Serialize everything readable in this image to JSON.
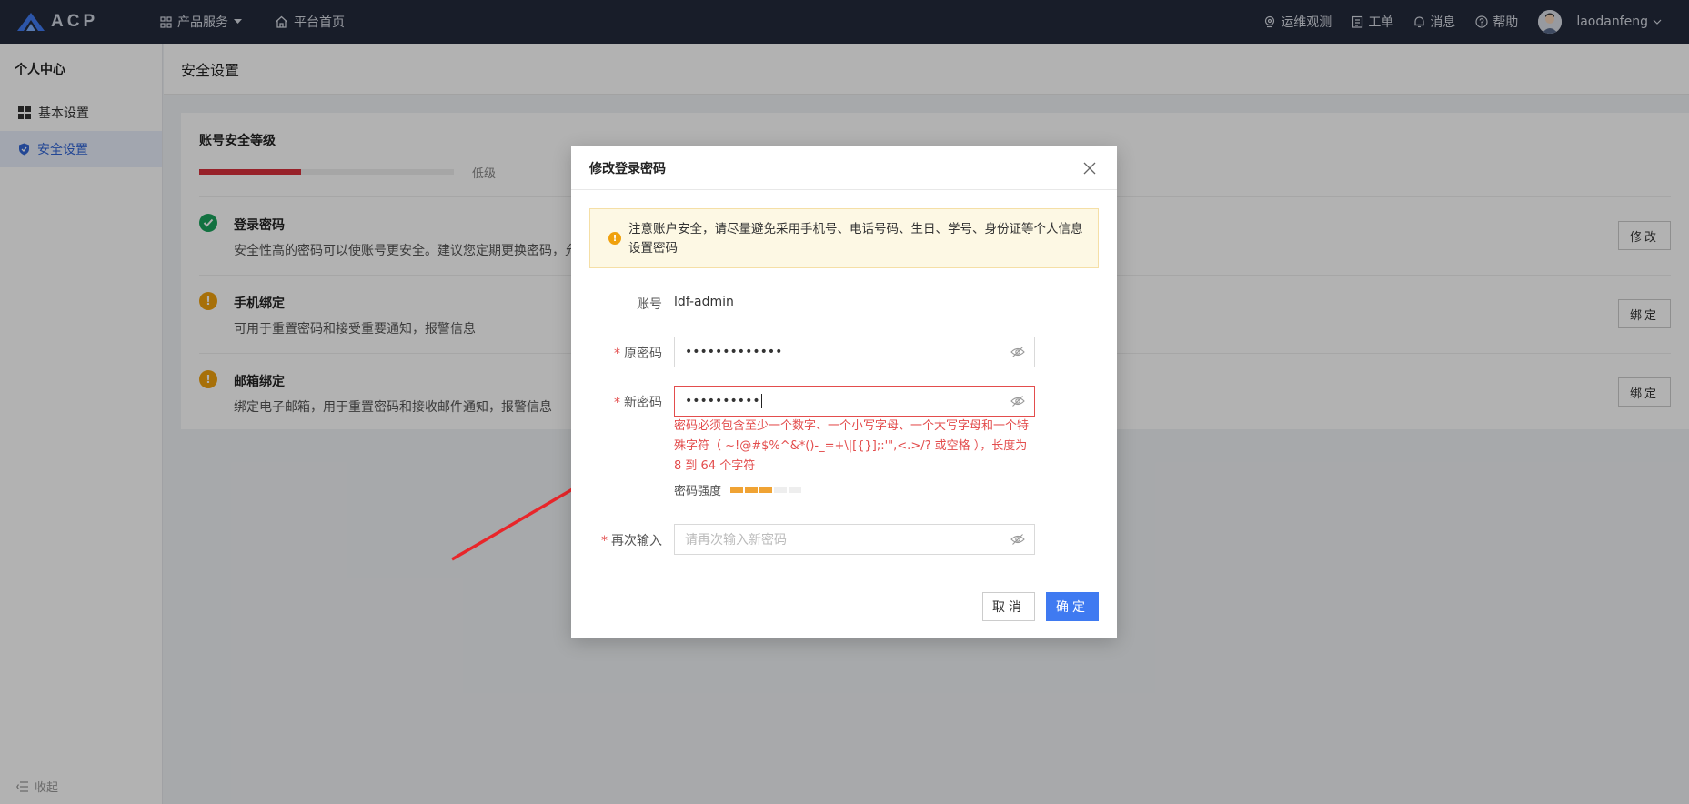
{
  "topbar": {
    "logo_text": "ACP",
    "nav": [
      {
        "label": "产品服务",
        "icon": "grid-icon"
      },
      {
        "label": "平台首页",
        "icon": "home-icon"
      }
    ],
    "right": [
      {
        "label": "运维观测",
        "icon": "monitor-icon"
      },
      {
        "label": "工单",
        "icon": "clipboard-icon"
      },
      {
        "label": "消息",
        "icon": "bell-icon"
      },
      {
        "label": "帮助",
        "icon": "help-icon"
      }
    ],
    "username": "laodanfeng"
  },
  "sidebar": {
    "title": "个人中心",
    "items": [
      {
        "label": "基本设置",
        "icon": "dashboard-icon",
        "active": false
      },
      {
        "label": "安全设置",
        "icon": "shield-icon",
        "active": true
      }
    ],
    "collapse_label": "收起"
  },
  "page": {
    "title": "安全设置",
    "card_title": "账号安全等级",
    "level_label": "低级",
    "level_fraction": 0.4,
    "rows": [
      {
        "title": "登录密码",
        "desc": "安全性高的密码可以使账号更安全。建议您定期更换密码，允",
        "button": "修改",
        "status": "ok"
      },
      {
        "title": "手机绑定",
        "desc": "可用于重置密码和接受重要通知，报警信息",
        "button": "绑定",
        "status": "warn"
      },
      {
        "title": "邮箱绑定",
        "desc": "绑定电子邮箱，用于重置密码和接收邮件通知，报警信息",
        "button": "绑定",
        "status": "warn"
      }
    ]
  },
  "modal": {
    "title": "修改登录密码",
    "notice": "注意账户安全，请尽量避免采用手机号、电话号码、生日、学号、身份证等个人信息设置密码",
    "account_label": "账号",
    "account_value": "ldf-admin",
    "old_password_label": "原密码",
    "old_password_value": "•••••••••••••",
    "new_password_label": "新密码",
    "new_password_value": "••••••••••",
    "new_password_error": "密码必须包含至少一个数字、一个小写字母、一个大写字母和一个特殊字符（ ~!@#$%^&*()-_=+\\|[{}];:'\",<.>/? 或空格 ），长度为 8 到 64 个字符",
    "strength_label": "密码强度",
    "strength_level": 3,
    "strength_total": 5,
    "confirm_label": "再次输入",
    "confirm_placeholder": "请再次输入新密码",
    "cancel_label": "取消",
    "ok_label": "确定"
  },
  "colors": {
    "topbar_bg": "#232a3b",
    "primary": "#3f7af1",
    "error": "#e34d4d",
    "warning": "#f0a10d",
    "success": "#1aa35c",
    "level_bar": "#d9303b"
  }
}
